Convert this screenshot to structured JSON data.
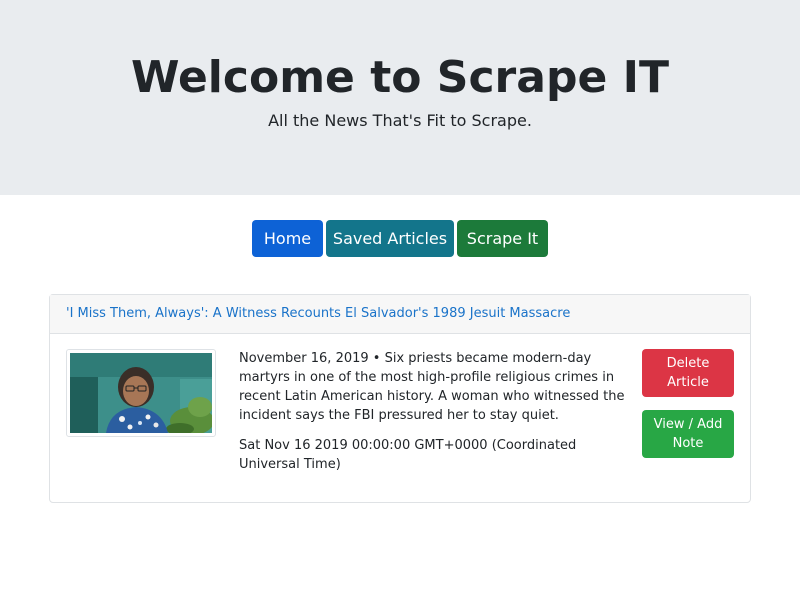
{
  "hero": {
    "title": "Welcome to Scrape IT",
    "subtitle": "All the News That's Fit to Scrape."
  },
  "nav": {
    "home_label": "Home",
    "saved_label": "Saved Articles",
    "scrape_label": "Scrape It"
  },
  "article": {
    "headline": "'I Miss Them, Always': A Witness Recounts El Salvador's 1989 Jesuit Massacre",
    "summary": "November 16, 2019 • Six priests became modern-day martyrs in one of the most high-profile religious crimes in recent Latin American history. A woman who witnessed the incident says the FBI pressured her to stay quiet.",
    "date": "Sat Nov 16 2019 00:00:00 GMT+0000 (Coordinated Universal Time)",
    "delete_label": "Delete\nArticle",
    "note_label": "View / Add\nNote",
    "image_alt": "article-thumbnail"
  },
  "colors": {
    "hero_bg": "#e9ecef",
    "home_btn": "#0d62d6",
    "saved_btn": "#13758b",
    "scrape_btn": "#1c7a3a",
    "delete_btn": "#dc3545",
    "note_btn": "#28a745",
    "link": "#1a73c9"
  }
}
